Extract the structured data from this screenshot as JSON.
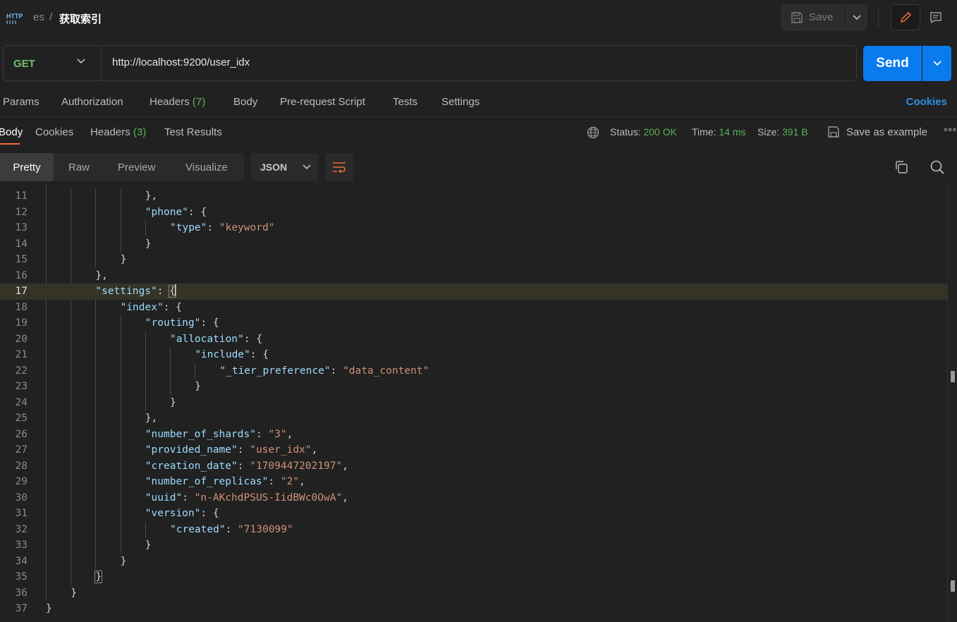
{
  "topbar": {
    "protocol_icon": "http-icon",
    "breadcrumb_collection": "es",
    "breadcrumb_separator": "/",
    "request_title": "获取索引",
    "save_label": "Save"
  },
  "request": {
    "method": "GET",
    "url": "http://localhost:9200/user_idx",
    "send_label": "Send"
  },
  "request_tabs": {
    "params": "Params",
    "authorization": "Authorization",
    "headers": "Headers",
    "headers_count": "(7)",
    "body": "Body",
    "prerequest": "Pre-request Script",
    "tests": "Tests",
    "settings": "Settings",
    "cookies": "Cookies"
  },
  "response_tabs": {
    "body": "Body",
    "cookies": "Cookies",
    "headers": "Headers",
    "headers_count": "(3)",
    "test_results": "Test Results"
  },
  "response_meta": {
    "status_label": "Status:",
    "status_value": "200 OK",
    "time_label": "Time:",
    "time_value": "14 ms",
    "size_label": "Size:",
    "size_value": "391 B",
    "save_example": "Save as example",
    "more": "∘∘∘"
  },
  "view_modes": {
    "pretty": "Pretty",
    "raw": "Raw",
    "preview": "Preview",
    "visualize": "Visualize",
    "format": "JSON"
  },
  "colors": {
    "accent_send": "#097bed",
    "status_green": "#5ab35a",
    "key_blue": "#9cdcfe",
    "string_orange": "#ce9178",
    "active_tab_underline": "#f26b3a"
  },
  "code": {
    "current_line": 17,
    "lines": [
      {
        "n": "11",
        "indent": 4,
        "tokens": [
          [
            "p",
            "},"
          ]
        ]
      },
      {
        "n": "12",
        "indent": 4,
        "tokens": [
          [
            "k",
            "\"phone\""
          ],
          [
            "p",
            ": {"
          ]
        ]
      },
      {
        "n": "13",
        "indent": 5,
        "tokens": [
          [
            "k",
            "\"type\""
          ],
          [
            "p",
            ": "
          ],
          [
            "s",
            "\"keyword\""
          ]
        ]
      },
      {
        "n": "14",
        "indent": 4,
        "tokens": [
          [
            "p",
            "}"
          ]
        ]
      },
      {
        "n": "15",
        "indent": 3,
        "tokens": [
          [
            "p",
            "}"
          ]
        ]
      },
      {
        "n": "16",
        "indent": 2,
        "tokens": [
          [
            "p",
            "},"
          ]
        ]
      },
      {
        "n": "17",
        "indent": 2,
        "tokens": [
          [
            "k",
            "\"settings\""
          ],
          [
            "p",
            ": "
          ],
          [
            "b",
            "{"
          ]
        ]
      },
      {
        "n": "18",
        "indent": 3,
        "tokens": [
          [
            "k",
            "\"index\""
          ],
          [
            "p",
            ": {"
          ]
        ]
      },
      {
        "n": "19",
        "indent": 4,
        "tokens": [
          [
            "k",
            "\"routing\""
          ],
          [
            "p",
            ": {"
          ]
        ]
      },
      {
        "n": "20",
        "indent": 5,
        "tokens": [
          [
            "k",
            "\"allocation\""
          ],
          [
            "p",
            ": {"
          ]
        ]
      },
      {
        "n": "21",
        "indent": 6,
        "tokens": [
          [
            "k",
            "\"include\""
          ],
          [
            "p",
            ": {"
          ]
        ]
      },
      {
        "n": "22",
        "indent": 7,
        "tokens": [
          [
            "k",
            "\"_tier_preference\""
          ],
          [
            "p",
            ": "
          ],
          [
            "s",
            "\"data_content\""
          ]
        ]
      },
      {
        "n": "23",
        "indent": 6,
        "tokens": [
          [
            "p",
            "}"
          ]
        ]
      },
      {
        "n": "24",
        "indent": 5,
        "tokens": [
          [
            "p",
            "}"
          ]
        ]
      },
      {
        "n": "25",
        "indent": 4,
        "tokens": [
          [
            "p",
            "},"
          ]
        ]
      },
      {
        "n": "26",
        "indent": 4,
        "tokens": [
          [
            "k",
            "\"number_of_shards\""
          ],
          [
            "p",
            ": "
          ],
          [
            "s",
            "\"3\""
          ],
          [
            "p",
            ","
          ]
        ]
      },
      {
        "n": "27",
        "indent": 4,
        "tokens": [
          [
            "k",
            "\"provided_name\""
          ],
          [
            "p",
            ": "
          ],
          [
            "s",
            "\"user_idx\""
          ],
          [
            "p",
            ","
          ]
        ]
      },
      {
        "n": "28",
        "indent": 4,
        "tokens": [
          [
            "k",
            "\"creation_date\""
          ],
          [
            "p",
            ": "
          ],
          [
            "s",
            "\"1709447202197\""
          ],
          [
            "p",
            ","
          ]
        ]
      },
      {
        "n": "29",
        "indent": 4,
        "tokens": [
          [
            "k",
            "\"number_of_replicas\""
          ],
          [
            "p",
            ": "
          ],
          [
            "s",
            "\"2\""
          ],
          [
            "p",
            ","
          ]
        ]
      },
      {
        "n": "30",
        "indent": 4,
        "tokens": [
          [
            "k",
            "\"uuid\""
          ],
          [
            "p",
            ": "
          ],
          [
            "s",
            "\"n-AKchdPSUS-IidBWc0OwA\""
          ],
          [
            "p",
            ","
          ]
        ]
      },
      {
        "n": "31",
        "indent": 4,
        "tokens": [
          [
            "k",
            "\"version\""
          ],
          [
            "p",
            ": {"
          ]
        ]
      },
      {
        "n": "32",
        "indent": 5,
        "tokens": [
          [
            "k",
            "\"created\""
          ],
          [
            "p",
            ": "
          ],
          [
            "s",
            "\"7130099\""
          ]
        ]
      },
      {
        "n": "33",
        "indent": 4,
        "tokens": [
          [
            "p",
            "}"
          ]
        ]
      },
      {
        "n": "34",
        "indent": 3,
        "tokens": [
          [
            "p",
            "}"
          ]
        ]
      },
      {
        "n": "35",
        "indent": 2,
        "tokens": [
          [
            "b",
            "}"
          ]
        ]
      },
      {
        "n": "36",
        "indent": 1,
        "tokens": [
          [
            "p",
            "}"
          ]
        ]
      },
      {
        "n": "37",
        "indent": 0,
        "tokens": [
          [
            "p",
            "}"
          ]
        ]
      }
    ]
  }
}
